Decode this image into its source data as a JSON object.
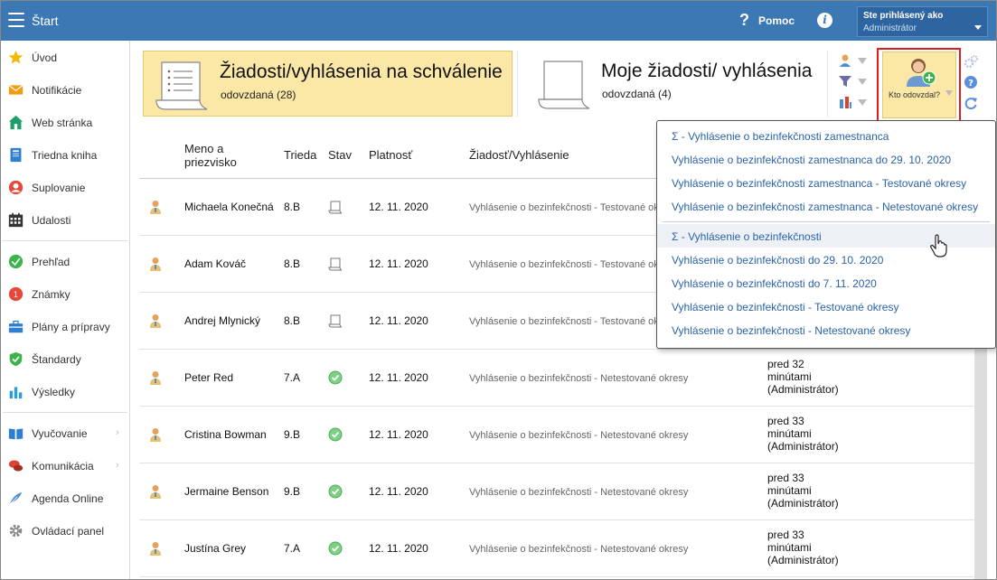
{
  "header": {
    "title": "Štart",
    "help_label": "Pomoc",
    "user_label": "Ste prihlásený ako",
    "user_name": "Administrátor"
  },
  "sidebar": {
    "items": [
      {
        "label": "Úvod",
        "icon": "star-icon"
      },
      {
        "label": "Notifikácie",
        "icon": "envelope-icon"
      },
      {
        "label": "Web stránka",
        "icon": "house-icon"
      },
      {
        "label": "Triedna kniha",
        "icon": "book-icon"
      },
      {
        "label": "Suplovanie",
        "icon": "person-icon"
      },
      {
        "label": "Udalosti",
        "icon": "calendar-icon"
      },
      {
        "label": "Prehľad",
        "icon": "check-circle-icon"
      },
      {
        "label": "Známky",
        "icon": "grade-icon"
      },
      {
        "label": "Plány a prípravy",
        "icon": "briefcase-icon"
      },
      {
        "label": "Štandardy",
        "icon": "shield-icon"
      },
      {
        "label": "Výsledky",
        "icon": "bar-chart-icon"
      },
      {
        "label": "Vyučovanie",
        "icon": "open-book-icon"
      },
      {
        "label": "Komunikácia",
        "icon": "chat-icon"
      },
      {
        "label": "Agenda Online",
        "icon": "feather-icon"
      },
      {
        "label": "Ovládací panel",
        "icon": "gear-icon"
      }
    ]
  },
  "cards": {
    "pending": {
      "title": "Žiadosti/vyhlásenia na schválenie",
      "sub": "odovzdaná (28)"
    },
    "mine": {
      "title": "Moje žiadosti/ vyhlásenia",
      "sub": "odovzdaná (4)"
    }
  },
  "toolbar": {
    "who_label": "Kto odovzdal?"
  },
  "table": {
    "headers": {
      "name": "Meno a priezvisko",
      "class": "Trieda",
      "state": "Stav",
      "valid": "Platnosť",
      "request": "Žiadosť/Vyhlásenie"
    },
    "rows": [
      {
        "name": "Michaela Konečná",
        "class": "8.B",
        "state": "document",
        "date": "12. 11. 2020",
        "request": "Vyhlásenie o bezinfekčnosti - Testované okresy",
        "who": ""
      },
      {
        "name": "Adam Kováč",
        "class": "8.B",
        "state": "document",
        "date": "12. 11. 2020",
        "request": "Vyhlásenie o bezinfekčnosti - Testované okresy",
        "who": ""
      },
      {
        "name": "Andrej Mlynický",
        "class": "8.B",
        "state": "document",
        "date": "12. 11. 2020",
        "request": "Vyhlásenie o bezinfekčnosti - Testované okresy",
        "who": ""
      },
      {
        "name": "Peter Red",
        "class": "7.A",
        "state": "approved",
        "date": "12. 11. 2020",
        "request": "Vyhlásenie o bezinfekčnosti - Netestované okresy",
        "who": "pred 32 minútami (Administrátor)"
      },
      {
        "name": "Cristina Bowman",
        "class": "9.B",
        "state": "approved",
        "date": "12. 11. 2020",
        "request": "Vyhlásenie o bezinfekčnosti - Netestované okresy",
        "who": "pred 33 minútami (Administrátor)"
      },
      {
        "name": "Jermaine Benson",
        "class": "9.B",
        "state": "approved",
        "date": "12. 11. 2020",
        "request": "Vyhlásenie o bezinfekčnosti - Netestované okresy",
        "who": "pred 33 minútami (Administrátor)"
      },
      {
        "name": "Justína Grey",
        "class": "7.A",
        "state": "approved",
        "date": "12. 11. 2020",
        "request": "Vyhlásenie o bezinfekčnosti - Netestované okresy",
        "who": "pred 33 minútami (Administrátor)"
      }
    ],
    "who_lines": [
      [
        "",
        "",
        ""
      ],
      [
        "",
        "",
        ""
      ],
      [
        "",
        "",
        ""
      ],
      [
        "pred 32",
        "minútami",
        "(Administrátor)"
      ],
      [
        "pred 33",
        "minútami",
        "(Administrátor)"
      ],
      [
        "pred 33",
        "minútami",
        "(Administrátor)"
      ],
      [
        "pred 33",
        "minútami",
        "(Administrátor)"
      ]
    ]
  },
  "dropdown": {
    "items": [
      "Σ - Vyhlásenie o bezinfekčnosti zamestnanca",
      "Vyhlásenie o bezinfekčnosti zamestnanca do 29. 10. 2020",
      "Vyhlásenie o bezinfekčnosti zamestnanca - Testované okresy",
      "Vyhlásenie o bezinfekčnosti zamestnanca - Netestované okresy",
      "Σ - Vyhlásenie o bezinfekčnosti",
      "Vyhlásenie o bezinfekčnosti do 29. 10. 2020",
      "Vyhlásenie o bezinfekčnosti do 7. 11. 2020",
      "Vyhlásenie o bezinfekčnosti - Testované okresy",
      "Vyhlásenie o bezinfekčnosti - Netestované okresy"
    ]
  },
  "colors": {
    "topbar": "#3c78b4",
    "accent_card": "#fbe8a6",
    "link": "#2a62a8",
    "highlight": "#e01d1d",
    "approved": "#4caf50"
  }
}
